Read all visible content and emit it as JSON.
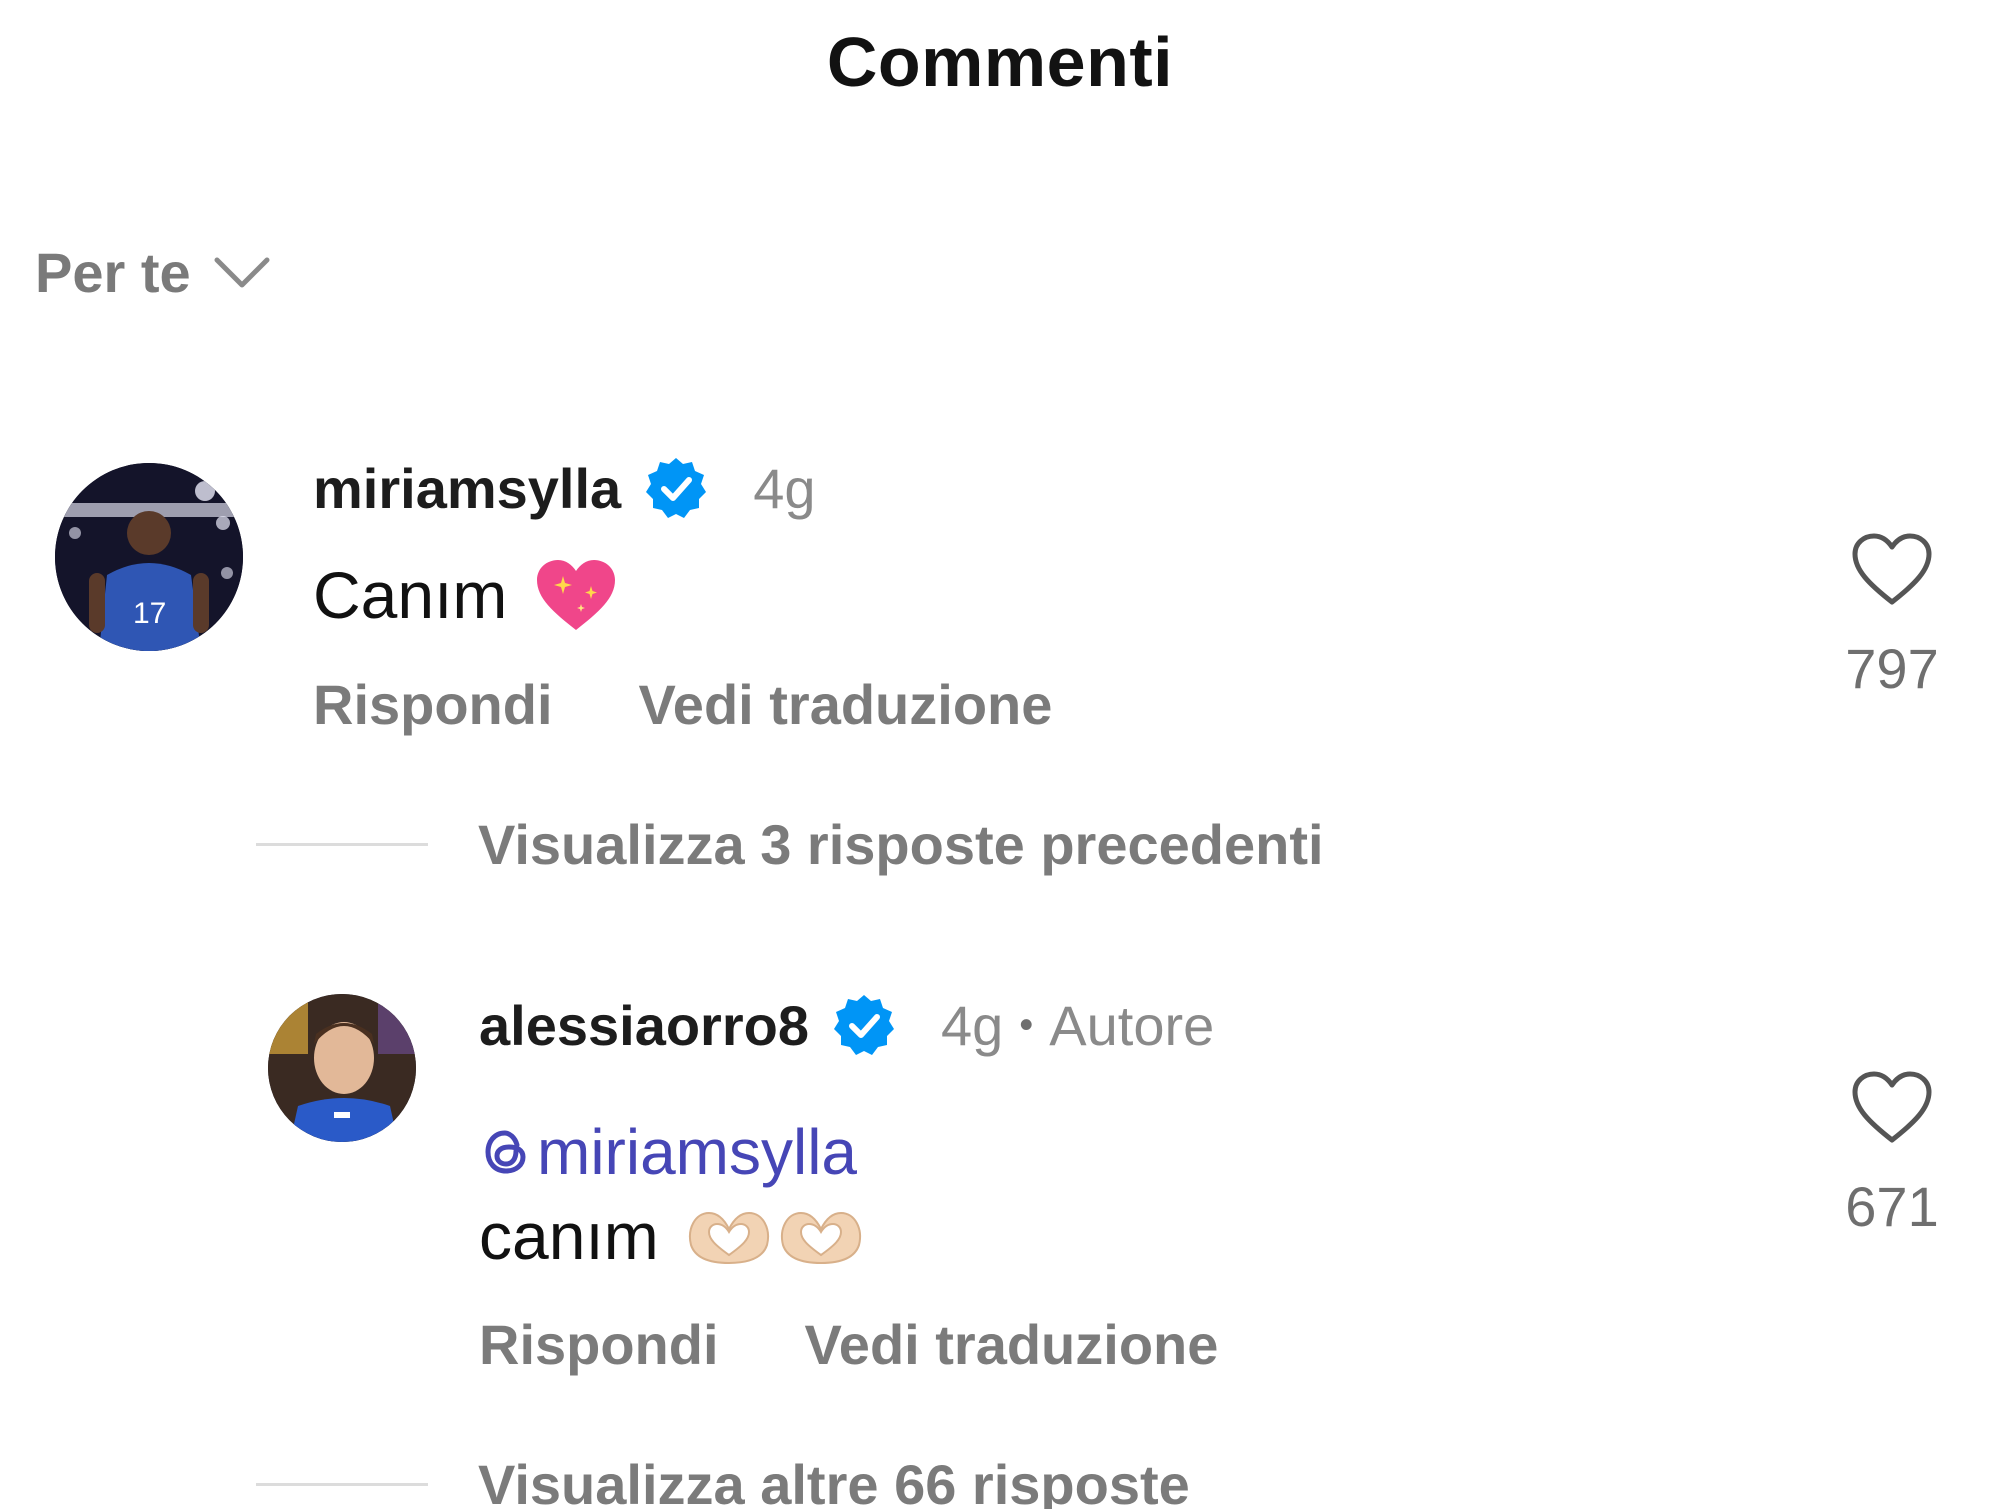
{
  "header": {
    "title": "Commenti"
  },
  "sort": {
    "label": "Per te"
  },
  "comments": [
    {
      "username": "miriamsylla",
      "time": "4g",
      "text": "Canım",
      "emoji": "sparkling-heart",
      "likes": "797",
      "reply_label": "Rispondi",
      "translate_label": "Vedi traduzione",
      "jersey_number": "17"
    }
  ],
  "view_previous_replies": "Visualizza 3 risposte precedenti",
  "reply": {
    "username": "alessiaorro8",
    "time": "4g",
    "author_tag": "Autore",
    "mention": "miriamsylla",
    "text": "canım",
    "emoji": "heart-hands",
    "likes": "671",
    "reply_label": "Rispondi",
    "translate_label": "Vedi traduzione"
  },
  "view_more_replies": "Visualizza altre 66 risposte",
  "colors": {
    "verified": "#0095f6",
    "mention": "#4646b6",
    "secondary_text": "#7b7b7b"
  }
}
